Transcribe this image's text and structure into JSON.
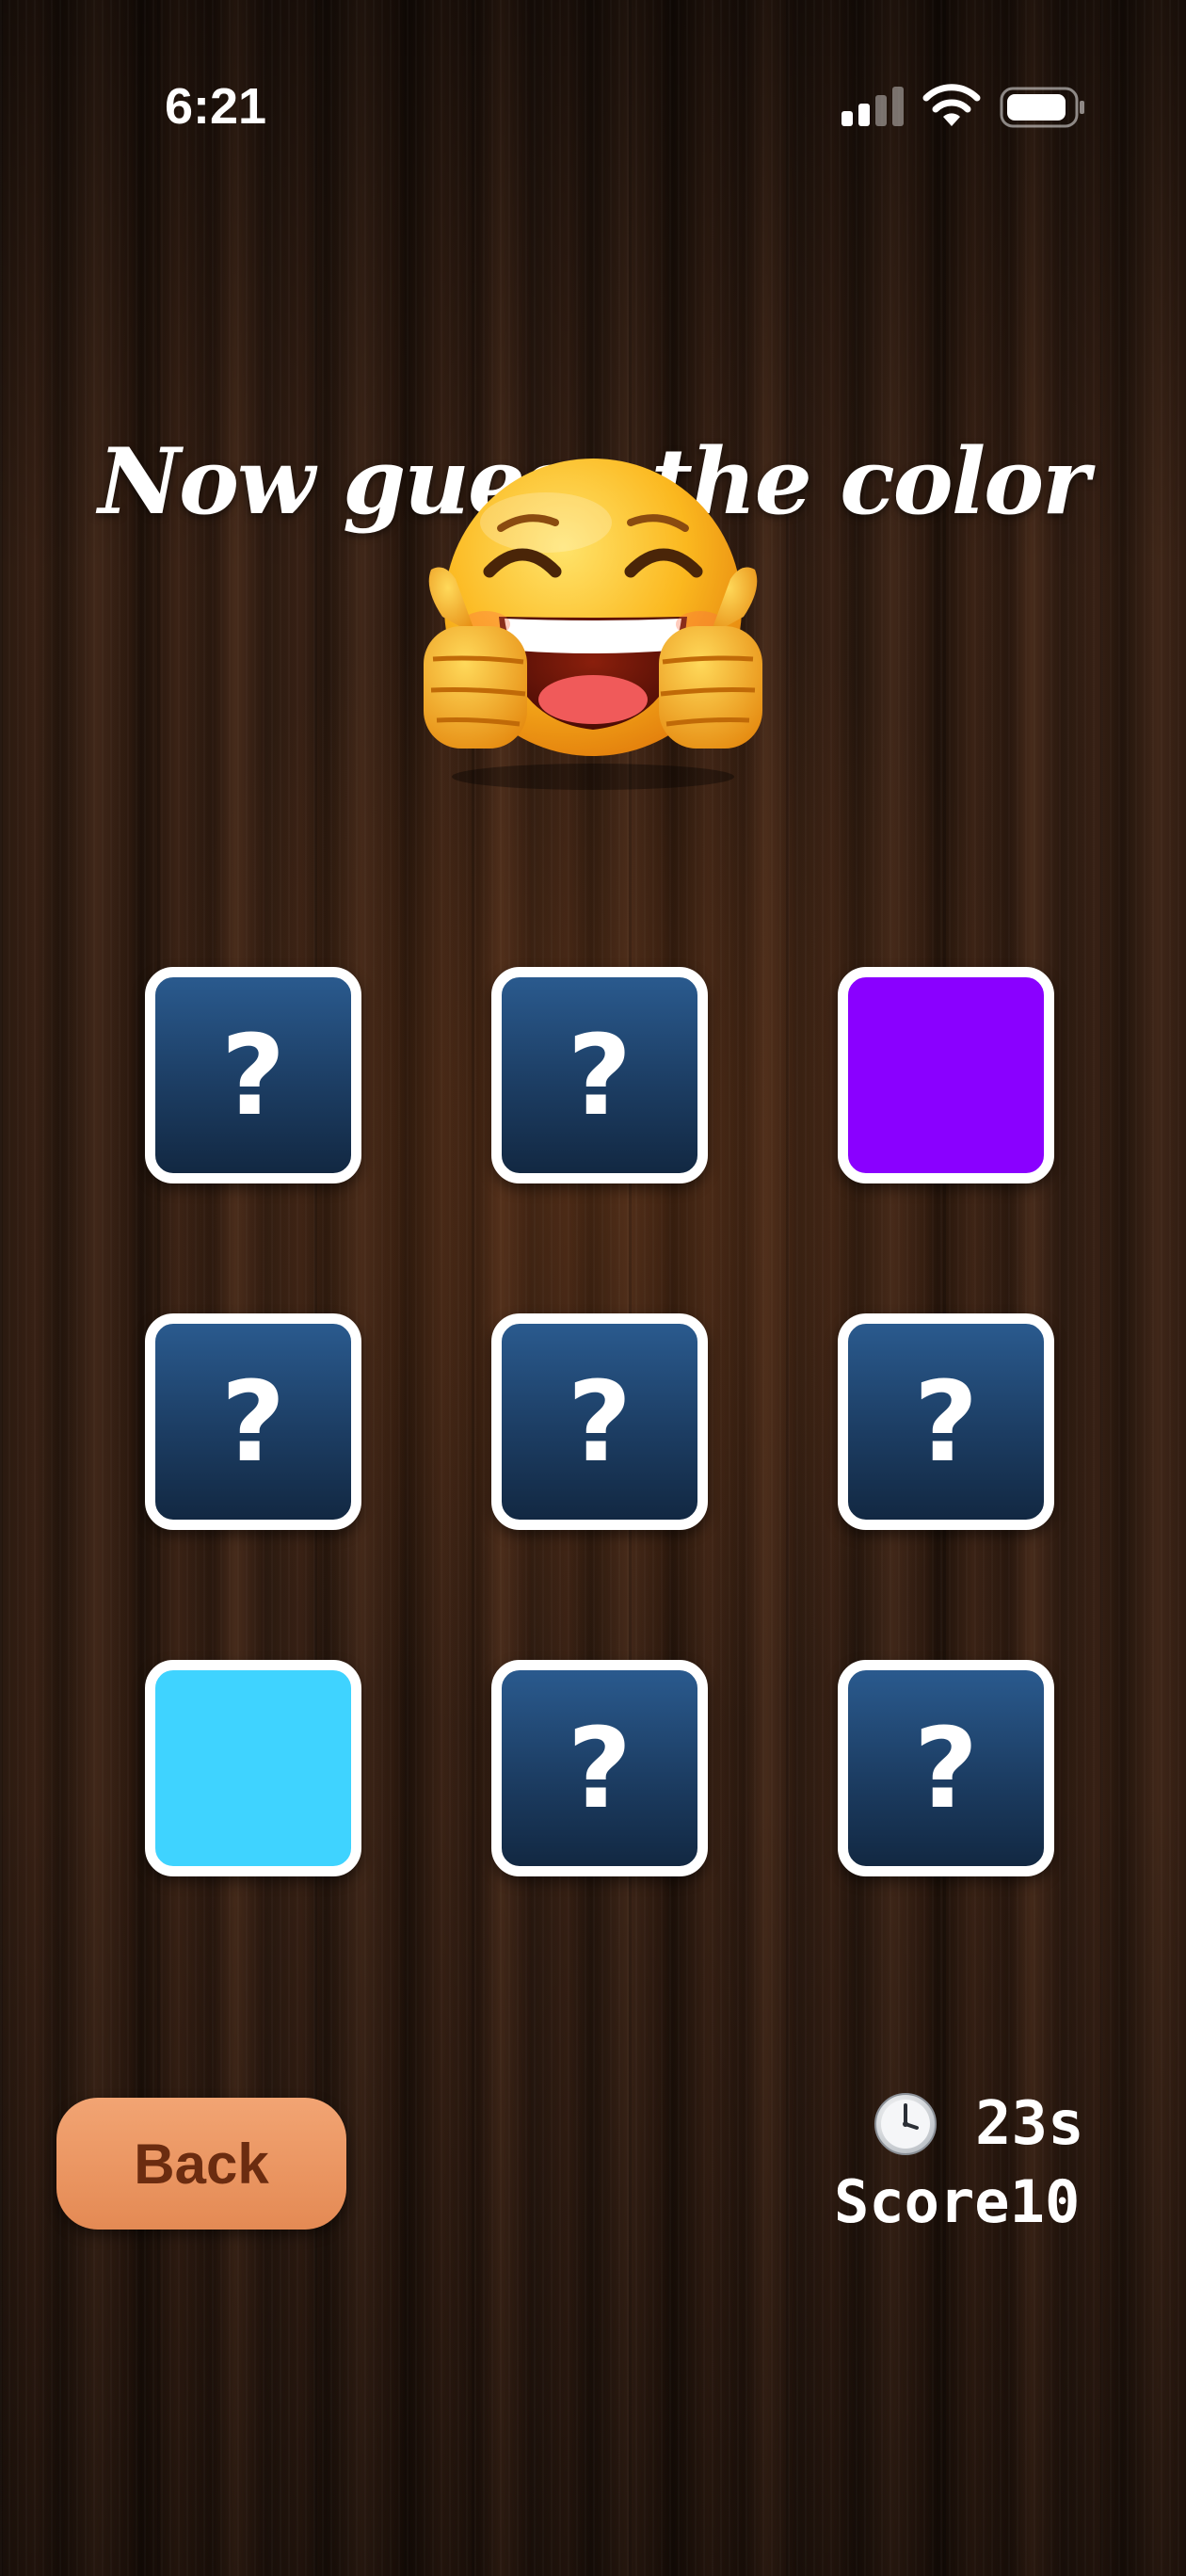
{
  "status_bar": {
    "time": "6:21"
  },
  "game": {
    "title": "Now guess the color",
    "emoji": "grinning-thumbs-up-emoji",
    "tiles": [
      {
        "state": "hidden",
        "mark": "?"
      },
      {
        "state": "hidden",
        "mark": "?"
      },
      {
        "state": "revealed",
        "mark": "",
        "color": "#8a00ff"
      },
      {
        "state": "hidden",
        "mark": "?"
      },
      {
        "state": "hidden",
        "mark": "?"
      },
      {
        "state": "hidden",
        "mark": "?"
      },
      {
        "state": "revealed",
        "mark": "",
        "color": "#3fd3ff"
      },
      {
        "state": "hidden",
        "mark": "?"
      },
      {
        "state": "hidden",
        "mark": "?"
      }
    ]
  },
  "controls": {
    "back_label": "Back",
    "timer": "23s",
    "score_label": "Score",
    "score_value": "10"
  },
  "colors": {
    "tile_hidden": "#1e4470",
    "tile_border": "#ffffff",
    "back_button": "#ec9663",
    "back_text": "#6b2c10"
  }
}
